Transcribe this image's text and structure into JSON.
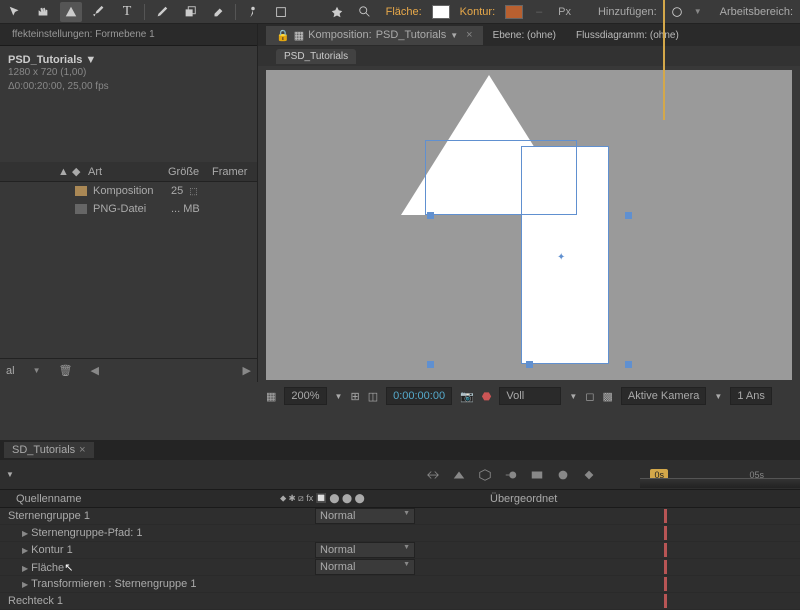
{
  "toolbar": {
    "fill_label": "Fläche:",
    "fill_color": "#ffffff",
    "stroke_label": "Kontur:",
    "stroke_color": "#b86030",
    "px_label": "Px",
    "add_label": "Hinzufügen:",
    "workspace_label": "Arbeitsbereich:"
  },
  "effect_panel": {
    "title": "ffekteinstellungen: Formebene 1"
  },
  "project": {
    "title": "PSD_Tutorials ▼",
    "resolution": "1280 x 720 (1,00)",
    "duration": "Δ0:00:20:00, 25,00 fps",
    "columns": {
      "art": "Art",
      "size": "Größe",
      "frames": "Framer"
    },
    "items": [
      {
        "type": "Komposition",
        "size": "25"
      },
      {
        "type": "PNG-Datei",
        "size": "... MB"
      }
    ],
    "bottom_label": "al"
  },
  "composition": {
    "prefix": "Komposition:",
    "name": "PSD_Tutorials",
    "layer_tab": "Ebene: (ohne)",
    "flow_tab": "Flussdiagramm: (ohne)",
    "inner_tab": "PSD_Tutorials"
  },
  "viewport_controls": {
    "zoom": "200%",
    "time": "0:00:00:00",
    "res": "Voll",
    "camera": "Aktive Kamera",
    "view": "1 Ans"
  },
  "timeline": {
    "tab": "SD_Tutorials",
    "time_marker": "0s",
    "time_label": "05s",
    "columns": {
      "source": "Quellenname",
      "parent": "Übergeordnet"
    },
    "layers": [
      {
        "name": "Sternengruppe 1",
        "mode": "Normal",
        "indent": 0,
        "expand": ""
      },
      {
        "name": "Sternengruppe-Pfad: 1",
        "mode": "",
        "indent": 1,
        "expand": "▶"
      },
      {
        "name": "Kontur 1",
        "mode": "Normal",
        "indent": 1,
        "expand": "▶"
      },
      {
        "name": "Fläche",
        "mode": "Normal",
        "indent": 1,
        "expand": "▶"
      },
      {
        "name": "Transformieren : Sternengruppe 1",
        "mode": "",
        "indent": 1,
        "expand": "▶"
      },
      {
        "name": "Rechteck 1",
        "mode": "",
        "indent": 0,
        "expand": ""
      }
    ]
  }
}
